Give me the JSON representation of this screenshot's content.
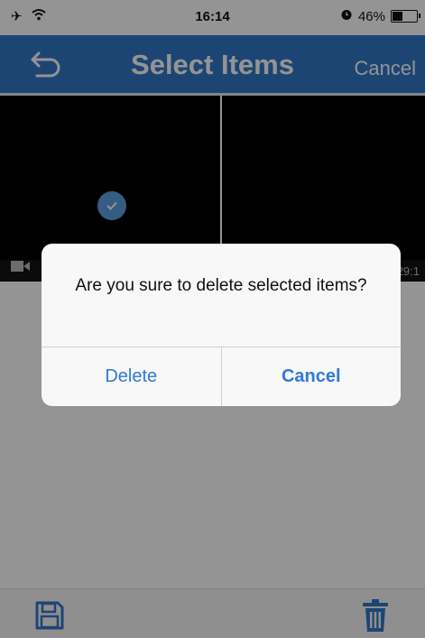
{
  "status_bar": {
    "time": "16:14",
    "battery_text": "46%",
    "battery_level": 0.46,
    "icons": [
      "airplane-icon",
      "wifi-icon",
      "alarm-icon",
      "battery-icon"
    ]
  },
  "nav": {
    "title": "Select Items",
    "cancel_label": "Cancel",
    "back_icon": "back-arrow-icon"
  },
  "grid": {
    "items": [
      {
        "selected": true,
        "time": ""
      },
      {
        "selected": false,
        "time": "29:1"
      }
    ]
  },
  "toolbar": {
    "save_icon": "save-icon",
    "delete_icon": "trash-icon"
  },
  "alert": {
    "message": "Are you sure to delete selected items?",
    "delete_label": "Delete",
    "cancel_label": "Cancel"
  },
  "colors": {
    "nav_background": "#3278c8",
    "alert_button_text": "#2f7ad6",
    "checkmark_badge": "#5c9fe0"
  }
}
